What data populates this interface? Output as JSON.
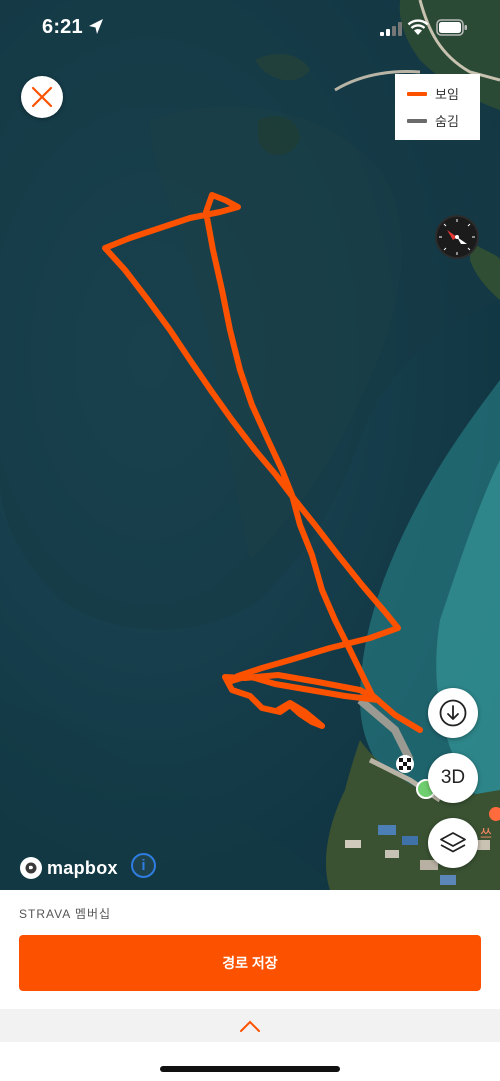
{
  "status_bar": {
    "time": "6:21",
    "icons": [
      "location-arrow-icon",
      "signal-icon",
      "wifi-icon",
      "battery-icon"
    ]
  },
  "map": {
    "close_icon": "close-icon",
    "legend": {
      "items": [
        {
          "label": "보임",
          "color": "#fc5200"
        },
        {
          "label": "숨김",
          "color": "#6b6b6b"
        }
      ]
    },
    "compass_icon": "compass-icon",
    "place_label": "쓰",
    "route_color": "#fc5200",
    "buttons": {
      "download_icon": "download-icon",
      "three_d_label": "3D",
      "layers_icon": "layers-icon"
    },
    "attribution": {
      "logo_text": "mapbox",
      "info_label": "i"
    }
  },
  "bottom_panel": {
    "membership_label": "STRAVA 멤버십",
    "save_button_label": "경로 저장",
    "expand_icon": "chevron-up-icon",
    "accent_color": "#fc5200"
  }
}
